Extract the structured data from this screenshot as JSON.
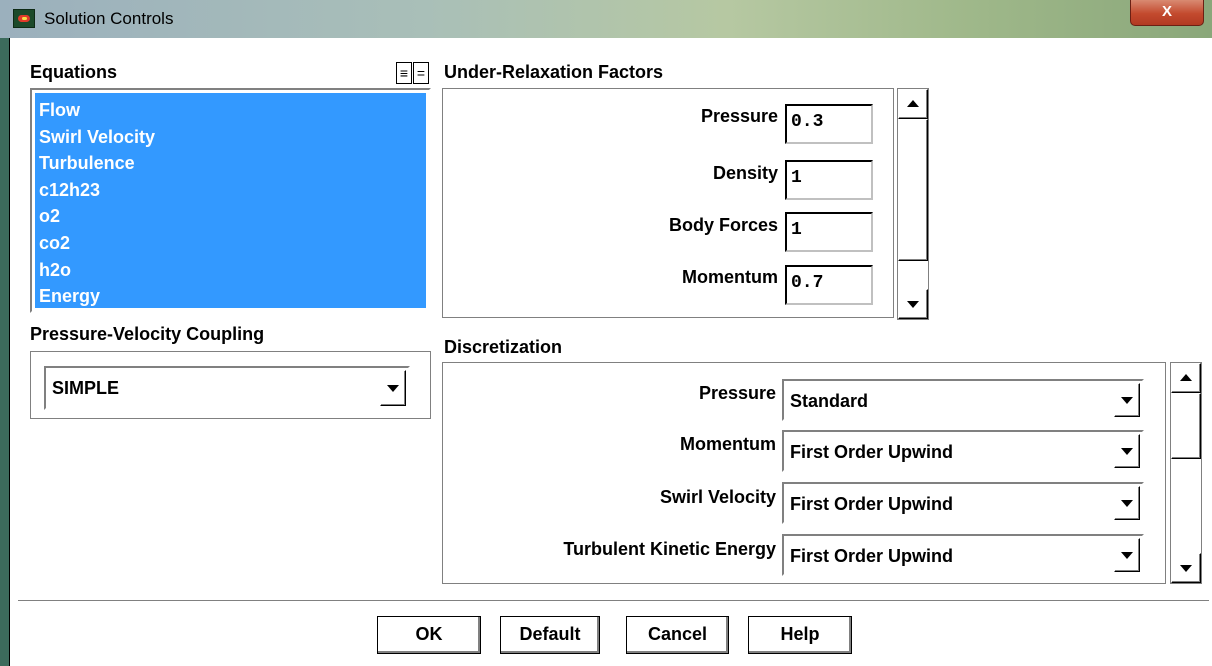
{
  "window": {
    "title": "Solution Controls",
    "close_label": "X"
  },
  "equations": {
    "label": "Equations",
    "select_all_label": "≡",
    "deselect_all_label": "=",
    "items": [
      "Flow",
      "Swirl Velocity",
      "Turbulence",
      "c12h23",
      "o2",
      "co2",
      "h2o",
      "Energy"
    ]
  },
  "pressure_velocity_coupling": {
    "label": "Pressure-Velocity Coupling",
    "value": "SIMPLE"
  },
  "under_relaxation": {
    "label": "Under-Relaxation Factors",
    "fields": [
      {
        "label": "Pressure",
        "value": "0.3"
      },
      {
        "label": "Density",
        "value": "1"
      },
      {
        "label": "Body Forces",
        "value": "1"
      },
      {
        "label": "Momentum",
        "value": "0.7"
      }
    ]
  },
  "discretization": {
    "label": "Discretization",
    "rows": [
      {
        "label": "Pressure",
        "value": "Standard"
      },
      {
        "label": "Momentum",
        "value": "First Order Upwind"
      },
      {
        "label": "Swirl Velocity",
        "value": "First Order Upwind"
      },
      {
        "label": "Turbulent Kinetic Energy",
        "value": "First Order Upwind"
      }
    ]
  },
  "buttons": {
    "ok": "OK",
    "default": "Default",
    "cancel": "Cancel",
    "help": "Help"
  },
  "colors": {
    "selection": "#3399ff",
    "close_button": "#c34a2e"
  }
}
